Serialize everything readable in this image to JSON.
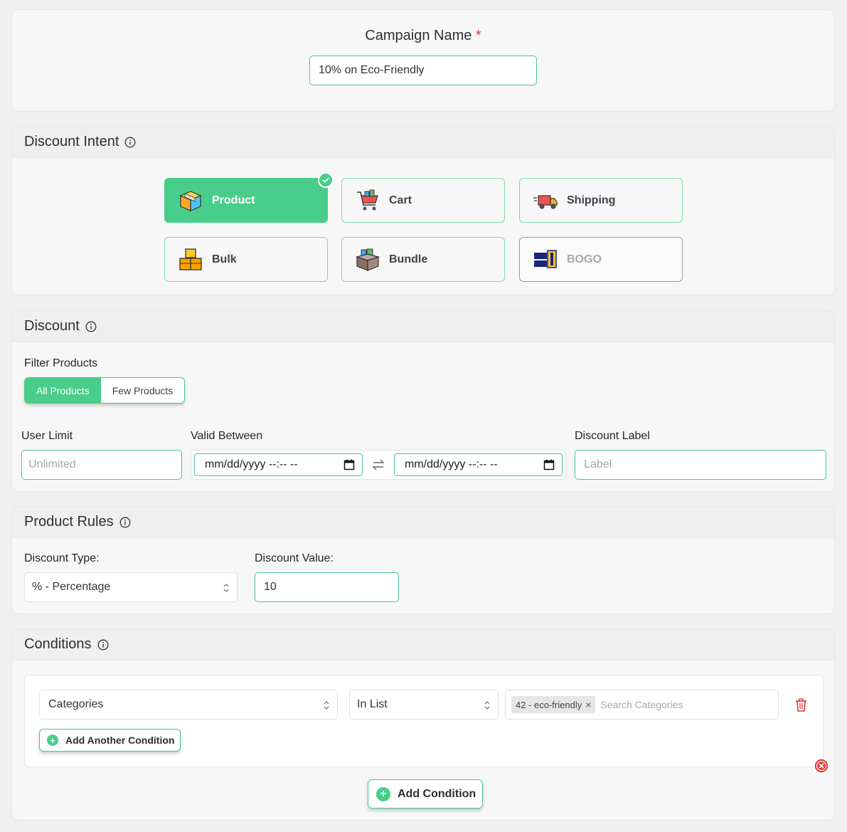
{
  "campaign": {
    "label": "Campaign Name",
    "required_mark": "*",
    "value": "10% on Eco-Friendly"
  },
  "intent": {
    "title": "Discount Intent",
    "options": [
      {
        "label": "Product",
        "icon": "box-icon",
        "state": "selected"
      },
      {
        "label": "Cart",
        "icon": "shopping-cart-icon",
        "state": "default"
      },
      {
        "label": "Shipping",
        "icon": "delivery-truck-icon",
        "state": "default"
      },
      {
        "label": "Bulk",
        "icon": "stacked-boxes-icon",
        "state": "default"
      },
      {
        "label": "Bundle",
        "icon": "bundle-box-icon",
        "state": "default"
      },
      {
        "label": "BOGO",
        "icon": "buy-get-1-icon",
        "state": "disabled"
      }
    ]
  },
  "discount": {
    "title": "Discount",
    "filter_label": "Filter Products",
    "filter_options": [
      "All Products",
      "Few Products"
    ],
    "filter_selected": "All Products",
    "user_limit_label": "User Limit",
    "user_limit_placeholder": "Unlimited",
    "valid_between_label": "Valid Between",
    "date_from": "mm/dd/yyyy --:-- --",
    "date_to": "mm/dd/yyyy --:-- --",
    "discount_label_label": "Discount Label",
    "discount_label_placeholder": "Label"
  },
  "rules": {
    "title": "Product Rules",
    "type_label": "Discount Type:",
    "type_value": "% - Percentage",
    "value_label": "Discount Value:",
    "value": "10"
  },
  "conditions": {
    "title": "Conditions",
    "field": "Categories",
    "operator": "In List",
    "chip": "42 - eco-friendly",
    "chip_remove": "×",
    "search_placeholder": "Search Categories",
    "add_another": "Add Another Condition",
    "add_condition": "Add Condition"
  },
  "colors": {
    "accent": "#48cd8a",
    "danger": "#e53935"
  }
}
